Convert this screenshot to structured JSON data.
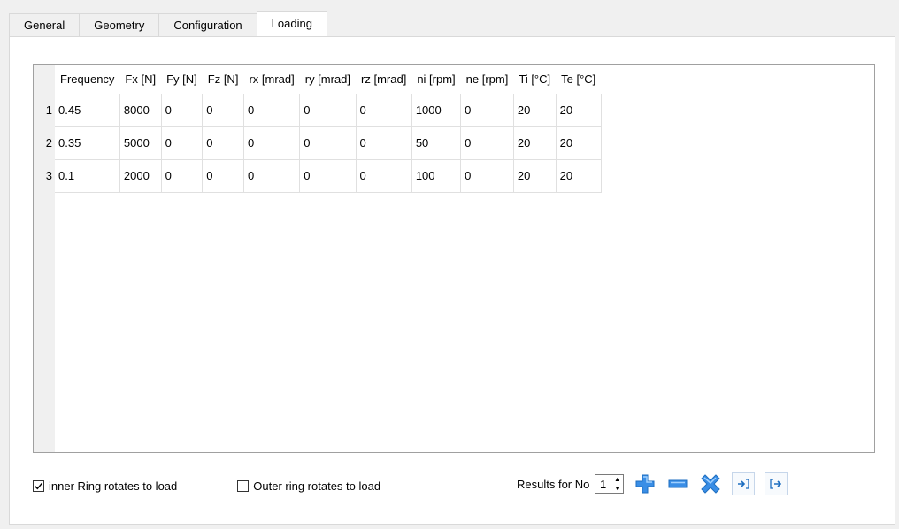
{
  "tabs": [
    {
      "label": "General"
    },
    {
      "label": "Geometry"
    },
    {
      "label": "Configuration"
    },
    {
      "label": "Loading"
    }
  ],
  "table": {
    "headers": [
      "Frequency",
      "Fx [N]",
      "Fy [N]",
      "Fz [N]",
      "rx [mrad]",
      "ry [mrad]",
      "rz [mrad]",
      "ni [rpm]",
      "ne [rpm]",
      "Ti [°C]",
      "Te [°C]"
    ],
    "rows": [
      {
        "num": "1",
        "cells": [
          "0.45",
          "8000",
          "0",
          "0",
          "0",
          "0",
          "0",
          "1000",
          "0",
          "20",
          "20"
        ]
      },
      {
        "num": "2",
        "cells": [
          "0.35",
          "5000",
          "0",
          "0",
          "0",
          "0",
          "0",
          "50",
          "0",
          "20",
          "20"
        ]
      },
      {
        "num": "3",
        "cells": [
          "0.1",
          "2000",
          "0",
          "0",
          "0",
          "0",
          "0",
          "100",
          "0",
          "20",
          "20"
        ]
      }
    ]
  },
  "options": {
    "inner_ring_label": "inner Ring rotates to load",
    "inner_ring_checked": true,
    "outer_ring_label": "Outer ring rotates to load",
    "outer_ring_checked": false
  },
  "results": {
    "label": "Results for No",
    "value": "1"
  },
  "toolbar": {
    "add_icon": "plus-icon",
    "remove_icon": "minus-icon",
    "clear_icon": "x-icon",
    "import_icon": "import-icon",
    "export_icon": "export-icon"
  },
  "colors": {
    "icon_blue": "#3a8ee6",
    "panel_border": "#d9d9d9",
    "grid_border": "#a0a0a0"
  }
}
